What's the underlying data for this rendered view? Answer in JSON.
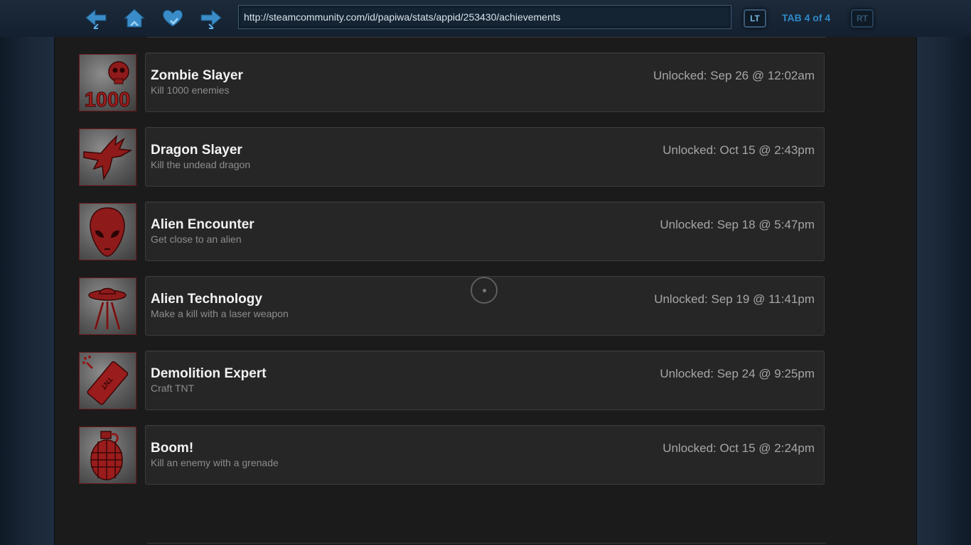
{
  "browser": {
    "url": "http://steamcommunity.com/id/papiwa/stats/appid/253430/achievements",
    "lt_label": "LT",
    "rt_label": "RT",
    "tab_indicator": "TAB 4 of 4",
    "nav_icons": [
      "back-arrow-icon",
      "home-icon",
      "favorite-heart-icon",
      "forward-arrow-icon"
    ],
    "accent_color": "#2f8ac8"
  },
  "achievements": [
    {
      "title": "Zombie Slayer",
      "description": "Kill 1000 enemies",
      "unlocked": "Unlocked: Sep 26 @ 12:02am",
      "icon": "skull-1000-icon"
    },
    {
      "title": "Dragon Slayer",
      "description": "Kill the undead dragon",
      "unlocked": "Unlocked: Oct 15 @ 2:43pm",
      "icon": "dragon-icon"
    },
    {
      "title": "Alien Encounter",
      "description": "Get close to an alien",
      "unlocked": "Unlocked: Sep 18 @ 5:47pm",
      "icon": "alien-head-icon"
    },
    {
      "title": "Alien Technology",
      "description": "Make a kill with a laser weapon",
      "unlocked": "Unlocked: Sep 19 @ 11:41pm",
      "icon": "ufo-icon"
    },
    {
      "title": "Demolition Expert",
      "description": "Craft TNT",
      "unlocked": "Unlocked: Sep 24 @ 9:25pm",
      "icon": "tnt-icon"
    },
    {
      "title": "Boom!",
      "description": "Kill an enemy with a grenade",
      "unlocked": "Unlocked: Oct 15 @ 2:24pm",
      "icon": "grenade-icon"
    }
  ],
  "icon_icon_text": "1000",
  "icon_color": "#8f1a1a"
}
